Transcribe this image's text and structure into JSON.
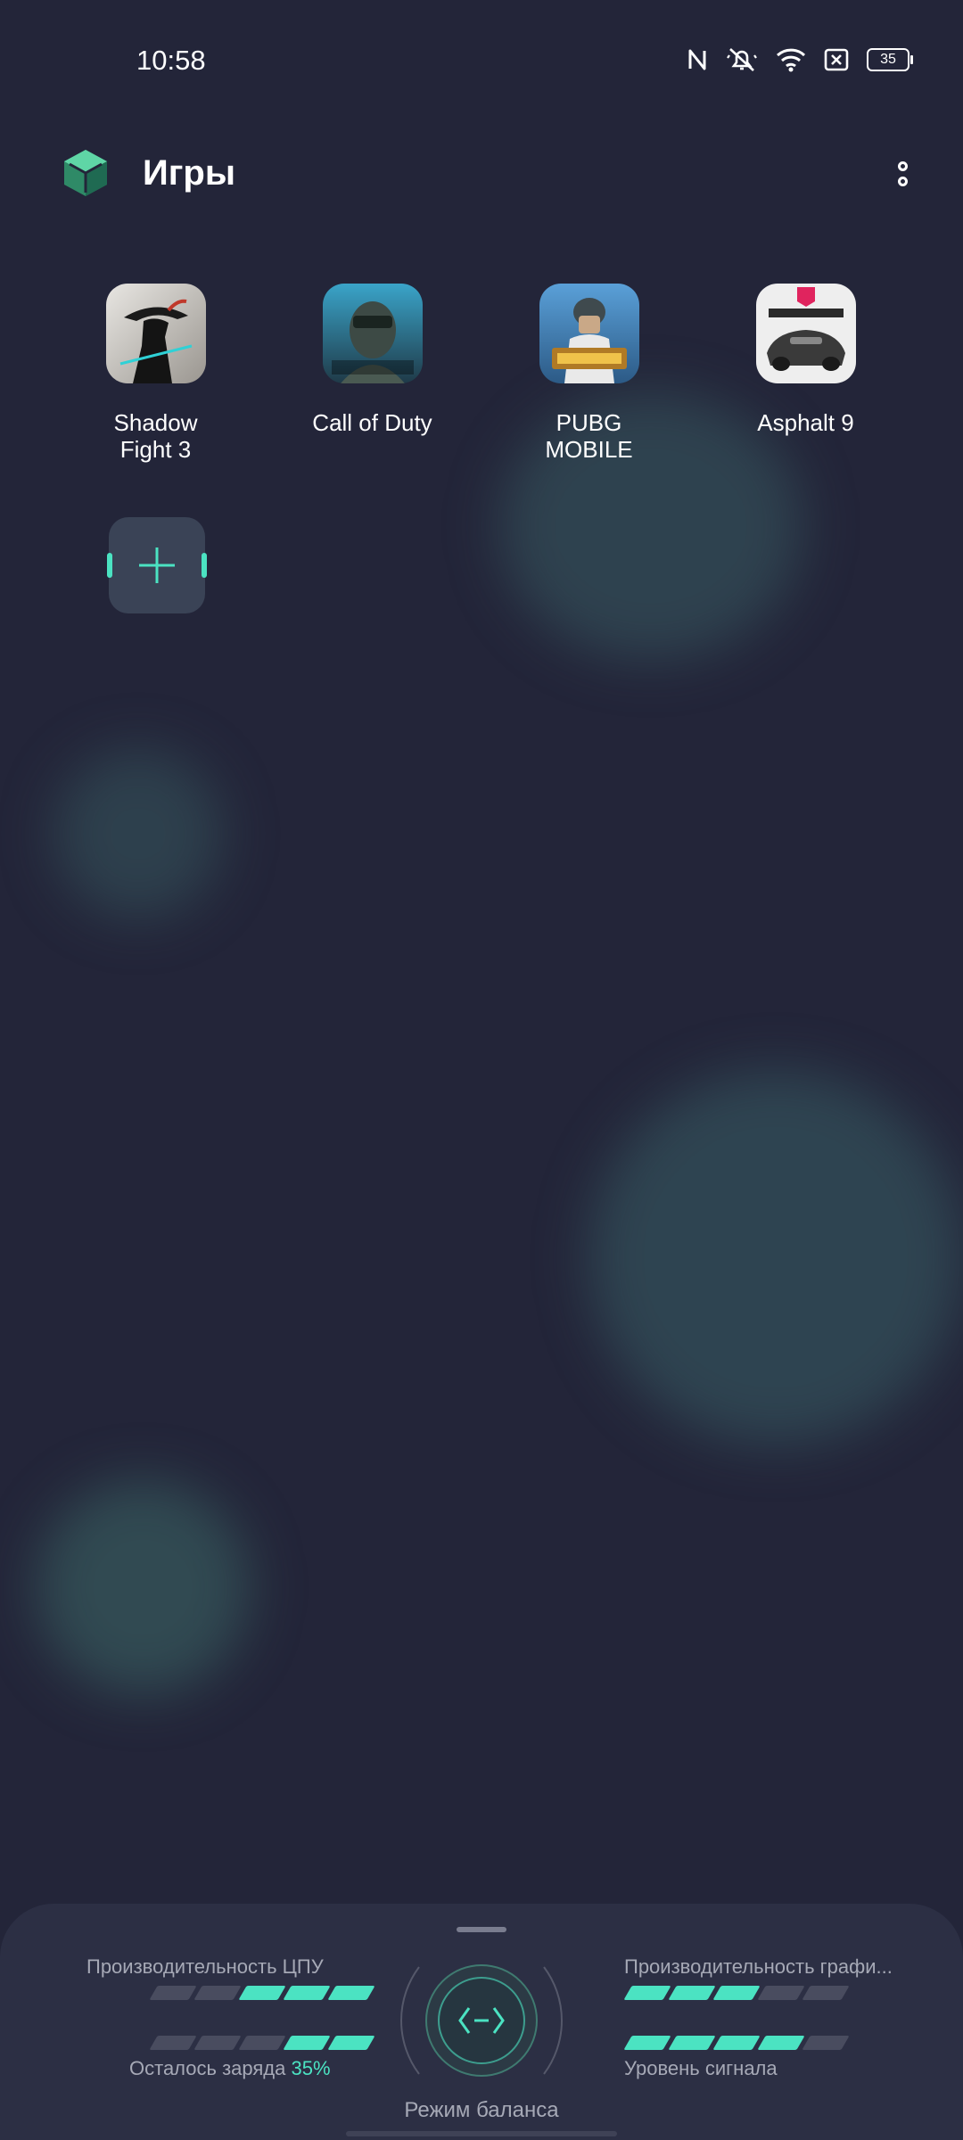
{
  "status_bar": {
    "time": "10:58",
    "battery": "35",
    "icons": [
      "nfc-icon",
      "mute-icon",
      "wifi-icon",
      "sim-off-icon",
      "battery-icon"
    ]
  },
  "header": {
    "title": "Игры",
    "logo_icon": "game-space-logo-icon",
    "menu_icon": "more-vertical-icon"
  },
  "games": [
    {
      "label": "Shadow\nFight 3",
      "icon": "shadow-fight-3-icon"
    },
    {
      "label": "Call of Duty",
      "icon": "call-of-duty-icon"
    },
    {
      "label": "PUBG\nMOBILE",
      "icon": "pubg-mobile-icon"
    },
    {
      "label": "Asphalt 9",
      "icon": "asphalt-9-icon"
    }
  ],
  "add_game": {
    "icon": "plus-icon"
  },
  "panel": {
    "cpu_label": "Производительность ЦПУ",
    "gpu_label": "Производительность графи...",
    "battery_label": "Осталось заряда",
    "battery_value": "35%",
    "signal_label": "Уровень сигнала",
    "mode_label": "Режим баланса",
    "mode_icon": "balance-mode-icon",
    "cpu_level": 3,
    "battery_level": 2,
    "gpu_level": 3,
    "signal_level": 4,
    "meter_max": 5
  },
  "colors": {
    "background": "#232539",
    "panel": "#2c2f44",
    "accent": "#4be3c2"
  }
}
